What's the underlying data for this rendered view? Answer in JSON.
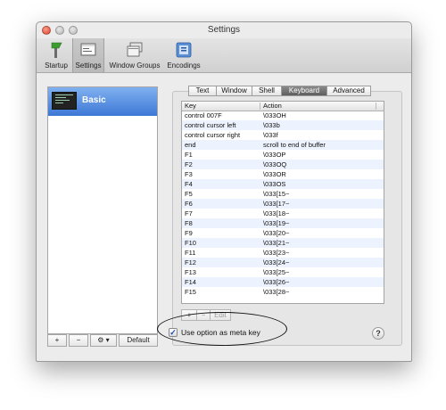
{
  "window": {
    "title": "Settings"
  },
  "toolbar": {
    "items": [
      {
        "label": "Startup",
        "icon": "startup-icon",
        "selected": false
      },
      {
        "label": "Settings",
        "icon": "settings-icon",
        "selected": true
      },
      {
        "label": "Window Groups",
        "icon": "window-groups-icon",
        "selected": false
      },
      {
        "label": "Encodings",
        "icon": "encodings-icon",
        "selected": false
      }
    ]
  },
  "profiles": {
    "items": [
      {
        "name": "Basic",
        "selected": true
      }
    ],
    "buttons": {
      "add": "+",
      "remove": "−",
      "gear": "⚙ ▾",
      "default": "Default"
    }
  },
  "tabs": [
    {
      "label": "Text",
      "active": false
    },
    {
      "label": "Window",
      "active": false
    },
    {
      "label": "Shell",
      "active": false
    },
    {
      "label": "Keyboard",
      "active": true
    },
    {
      "label": "Advanced",
      "active": false
    }
  ],
  "keyboard": {
    "columns": [
      "Key",
      "Action"
    ],
    "rows": [
      [
        "control 007F",
        "\\033OH"
      ],
      [
        "control cursor left",
        "\\033b"
      ],
      [
        "control cursor right",
        "\\033f"
      ],
      [
        "end",
        "scroll to end of buffer"
      ],
      [
        "F1",
        "\\033OP"
      ],
      [
        "F2",
        "\\033OQ"
      ],
      [
        "F3",
        "\\033OR"
      ],
      [
        "F4",
        "\\033OS"
      ],
      [
        "F5",
        "\\033[15~"
      ],
      [
        "F6",
        "\\033[17~"
      ],
      [
        "F7",
        "\\033[18~"
      ],
      [
        "F8",
        "\\033[19~"
      ],
      [
        "F9",
        "\\033[20~"
      ],
      [
        "F10",
        "\\033[21~"
      ],
      [
        "F11",
        "\\033[23~"
      ],
      [
        "F12",
        "\\033[24~"
      ],
      [
        "F13",
        "\\033[25~"
      ],
      [
        "F14",
        "\\033[26~"
      ],
      [
        "F15",
        "\\033[28~"
      ]
    ],
    "buttons": {
      "add": "+",
      "remove": "−",
      "edit": "Edit"
    },
    "meta_option": {
      "label": "Use option as meta key",
      "checked": true
    }
  },
  "help": {
    "label": "?"
  },
  "colors": {
    "selection": "#3d78d6",
    "active_tab": "#6e6e6e",
    "annotation": "#111111"
  }
}
